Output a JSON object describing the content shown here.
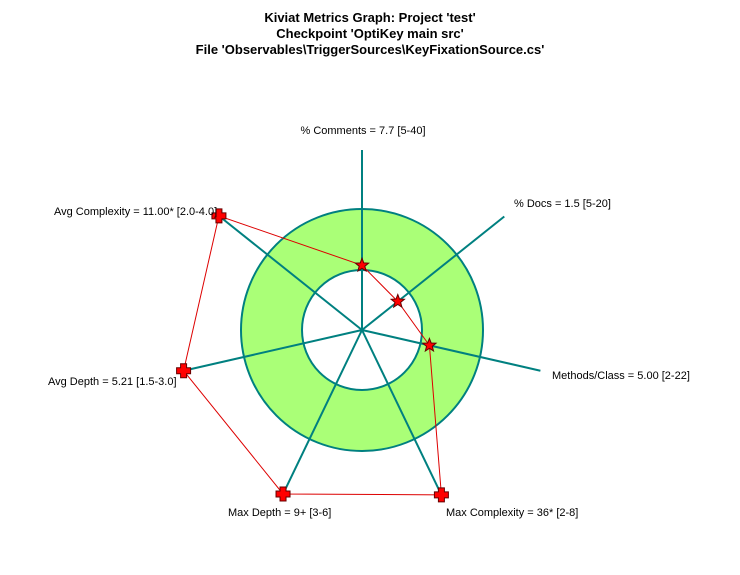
{
  "titles": [
    "Kiviat Metrics Graph: Project 'test'",
    "Checkpoint 'OptiKey main src'",
    "File 'Observables\\TriggerSources\\KeyFixationSource.cs'"
  ],
  "chart_data": {
    "type": "radar",
    "title": "Kiviat Metrics Graph: Project 'test'",
    "subtitle": [
      "Checkpoint 'OptiKey main src'",
      "File 'Observables\\TriggerSources\\KeyFixationSource.cs'"
    ],
    "axes": [
      {
        "label": "% Comments = 7.7 [5-40]",
        "metric": "% Comments",
        "value": 7.7,
        "range": [
          5,
          40
        ],
        "out_of_range": false
      },
      {
        "label": "% Docs = 1.5 [5-20]",
        "metric": "% Docs",
        "value": 1.5,
        "range": [
          5,
          20
        ],
        "out_of_range": false
      },
      {
        "label": "Methods/Class = 5.00 [2-22]",
        "metric": "Methods/Class",
        "value": 5.0,
        "range": [
          2,
          22
        ],
        "out_of_range": false
      },
      {
        "label": "Max Complexity = 36* [2-8]",
        "metric": "Max Complexity",
        "value": 36,
        "range": [
          2,
          8
        ],
        "out_of_range": true
      },
      {
        "label": "Max Depth = 9+ [3-6]",
        "metric": "Max Depth",
        "value": 9,
        "range": [
          3,
          6
        ],
        "out_of_range": true
      },
      {
        "label": "Avg Depth = 5.21 [1.5-3.0]",
        "metric": "Avg Depth",
        "value": 5.21,
        "range": [
          1.5,
          3.0
        ],
        "out_of_range": true
      },
      {
        "label": "Avg Complexity = 11.00* [2.0-4.0]",
        "metric": "Avg Complexity",
        "value": 11.0,
        "range": [
          2.0,
          4.0
        ],
        "out_of_range": true
      }
    ],
    "colors": {
      "band_fill": "#aaff77",
      "axis": "#008080",
      "polygon": "#dd0000",
      "marker": "#ff0000",
      "marker_outline": "#660000"
    }
  }
}
